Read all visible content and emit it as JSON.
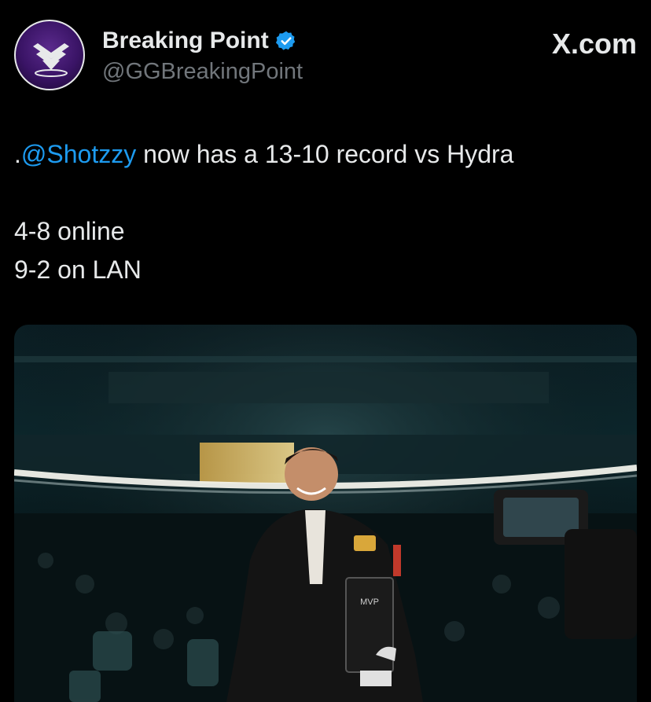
{
  "account": {
    "display_name": "Breaking Point",
    "handle": "@GGBreakingPoint",
    "verified_icon": "verified-badge-icon",
    "avatar_icon": "breaking-point-logo-icon"
  },
  "brand": {
    "watermark": "X.com"
  },
  "tweet": {
    "prefix": ".",
    "mention": "@Shotzzy",
    "line1_rest": " now has a 13-10 record vs Hydra",
    "line2": "4-8 online",
    "line3": "9-2 on LAN"
  },
  "colors": {
    "background": "#000000",
    "text": "#e7e9ea",
    "secondary": "#71767b",
    "link": "#1d9bf0",
    "verified": "#1d9bf0"
  },
  "media": {
    "type": "photo",
    "trophy_text": "MVP"
  }
}
